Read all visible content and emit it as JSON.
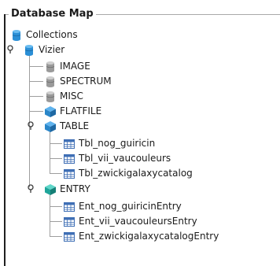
{
  "panel": {
    "title": "Database Map"
  },
  "tree": {
    "root": {
      "label": "Collections",
      "icon": "database-blue-icon"
    },
    "vizier": {
      "label": "Vizier",
      "icon": "database-blue-icon",
      "expanded": true
    },
    "image": {
      "label": "IMAGE",
      "icon": "database-gray-icon"
    },
    "spectrum": {
      "label": "SPECTRUM",
      "icon": "database-gray-icon"
    },
    "misc": {
      "label": "MISC",
      "icon": "database-gray-icon"
    },
    "flatfile": {
      "label": "FLATFILE",
      "icon": "cube-blue-icon"
    },
    "table": {
      "label": "TABLE",
      "icon": "cube-blue-icon",
      "expanded": true,
      "children": [
        {
          "label": "Tbl_nog_guiricin",
          "icon": "table-icon"
        },
        {
          "label": "Tbl_vii_vaucouleurs",
          "icon": "table-icon"
        },
        {
          "label": "Tbl_zwickigalaxycatalog",
          "icon": "table-icon"
        }
      ]
    },
    "entry": {
      "label": "ENTRY",
      "icon": "cube-teal-icon",
      "expanded": true,
      "children": [
        {
          "label": "Ent_nog_guiricinEntry",
          "icon": "table-icon"
        },
        {
          "label": "Ent_vii_vaucouleursEntry",
          "icon": "table-icon"
        },
        {
          "label": "Ent_zwickigalaxycatalogEntry",
          "icon": "table-icon"
        }
      ]
    }
  },
  "colors": {
    "db_blue": "#2b8fd6",
    "db_gray": "#9a9a9a",
    "cube_blue": "#2a86c9",
    "cube_teal": "#1fa59a",
    "table_blue": "#3f6fb5"
  }
}
